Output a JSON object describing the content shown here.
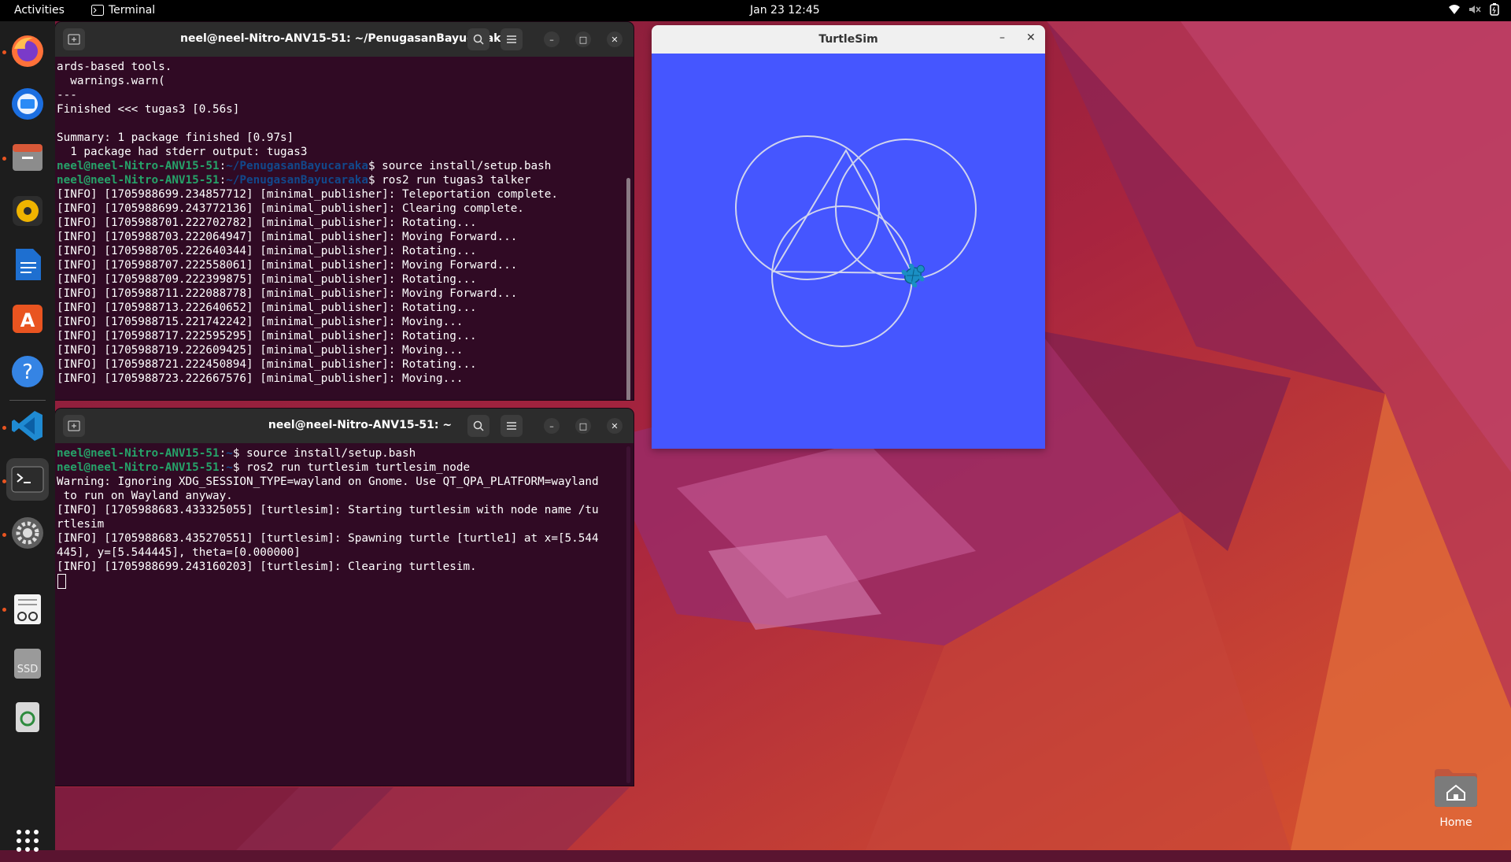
{
  "topbar": {
    "activities": "Activities",
    "app_name": "Terminal",
    "clock": "Jan 23  12:45",
    "tray_icons": [
      "wifi-icon",
      "volume-muted-icon",
      "battery-icon"
    ]
  },
  "dock": {
    "items": [
      "firefox-icon",
      "thunderbird-icon",
      "files-icon",
      "rhythmbox-icon",
      "libreoffice-writer-icon",
      "ubuntu-software-icon",
      "help-icon",
      "vscode-icon",
      "terminal-icon",
      "settings-icon",
      "text-editor-icon",
      "ssd-drive-icon",
      "trash-icon",
      "show-apps-icon"
    ],
    "ssd_label": "SSD"
  },
  "terminal_top": {
    "title": "neel@neel-Nitro-ANV15-51: ~/PenugasanBayucaraka",
    "lines": [
      {
        "t": "ards-based tools."
      },
      {
        "t": "  warnings.warn("
      },
      {
        "t": "---"
      },
      {
        "t": "Finished <<< tugas3 [0.56s]"
      },
      {
        "t": ""
      },
      {
        "t": "Summary: 1 package finished [0.97s]"
      },
      {
        "t": "  1 package had stderr output: tugas3"
      },
      {
        "user": "neel@neel-Nitro-ANV15-51",
        "sep": ":",
        "path": "~/PenugasanBayucaraka",
        "cmd": "$ source install/setup.bash"
      },
      {
        "user": "neel@neel-Nitro-ANV15-51",
        "sep": ":",
        "path": "~/PenugasanBayucaraka",
        "cmd": "$ ros2 run tugas3 talker"
      },
      {
        "t": "[INFO] [1705988699.234857712] [minimal_publisher]: Teleportation complete."
      },
      {
        "t": "[INFO] [1705988699.243772136] [minimal_publisher]: Clearing complete."
      },
      {
        "t": "[INFO] [1705988701.222702782] [minimal_publisher]: Rotating..."
      },
      {
        "t": "[INFO] [1705988703.222064947] [minimal_publisher]: Moving Forward..."
      },
      {
        "t": "[INFO] [1705988705.222640344] [minimal_publisher]: Rotating..."
      },
      {
        "t": "[INFO] [1705988707.222558061] [minimal_publisher]: Moving Forward..."
      },
      {
        "t": "[INFO] [1705988709.222399875] [minimal_publisher]: Rotating..."
      },
      {
        "t": "[INFO] [1705988711.222088778] [minimal_publisher]: Moving Forward..."
      },
      {
        "t": "[INFO] [1705988713.222640652] [minimal_publisher]: Rotating..."
      },
      {
        "t": "[INFO] [1705988715.221742242] [minimal_publisher]: Moving..."
      },
      {
        "t": "[INFO] [1705988717.222595295] [minimal_publisher]: Rotating..."
      },
      {
        "t": "[INFO] [1705988719.222609425] [minimal_publisher]: Moving..."
      },
      {
        "t": "[INFO] [1705988721.222450894] [minimal_publisher]: Rotating..."
      },
      {
        "t": "[INFO] [1705988723.222667576] [minimal_publisher]: Moving..."
      }
    ]
  },
  "terminal_bottom": {
    "title": "neel@neel-Nitro-ANV15-51: ~",
    "lines": [
      {
        "user": "neel@neel-Nitro-ANV15-51",
        "sep": ":",
        "path": "~",
        "cmd": "$ source install/setup.bash"
      },
      {
        "user": "neel@neel-Nitro-ANV15-51",
        "sep": ":",
        "path": "~",
        "cmd": "$ ros2 run turtlesim turtlesim_node"
      },
      {
        "t": "Warning: Ignoring XDG_SESSION_TYPE=wayland on Gnome. Use QT_QPA_PLATFORM=wayland"
      },
      {
        "t": " to run on Wayland anyway."
      },
      {
        "t": "[INFO] [1705988683.433325055] [turtlesim]: Starting turtlesim with node name /tu"
      },
      {
        "t": "rtlesim"
      },
      {
        "t": "[INFO] [1705988683.435270551] [turtlesim]: Spawning turtle [turtle1] at x=[5.544"
      },
      {
        "t": "445], y=[5.544445], theta=[0.000000]"
      },
      {
        "t": "[INFO] [1705988699.243160203] [turtlesim]: Clearing turtlesim."
      },
      {
        "cursor": true
      }
    ]
  },
  "turtlesim": {
    "title": "TurtleSim",
    "minimize": "–",
    "close": "✕",
    "background_color": "#4556ff",
    "trail_color": "#d0d4ee"
  },
  "desktop": {
    "home_label": "Home"
  }
}
